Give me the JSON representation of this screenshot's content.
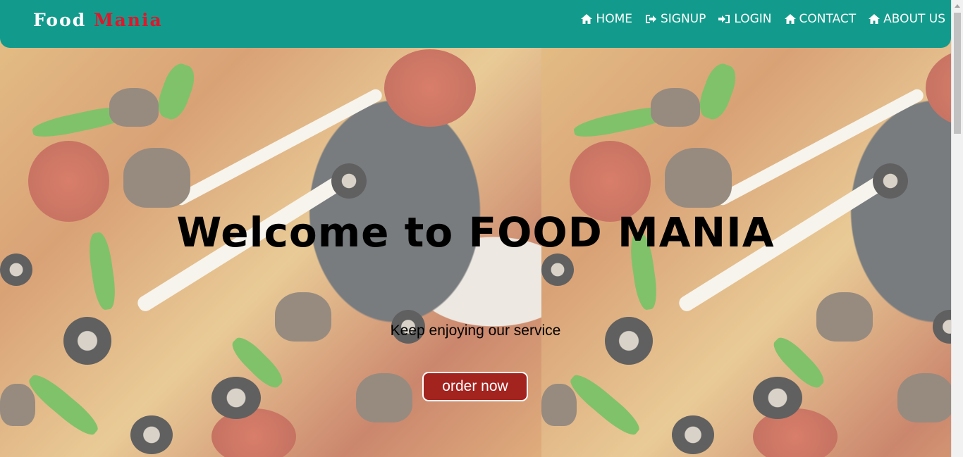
{
  "brand": {
    "first": "Food",
    "second": "Mania"
  },
  "nav": {
    "items": [
      {
        "label": "HOME",
        "icon": "home-icon"
      },
      {
        "label": "SIGNUP",
        "icon": "sign-out-icon"
      },
      {
        "label": "LOGIN",
        "icon": "sign-in-icon"
      },
      {
        "label": "CONTACT",
        "icon": "home-icon"
      },
      {
        "label": "ABOUT US",
        "icon": "home-icon"
      }
    ]
  },
  "hero": {
    "title": "Welcome to FOOD MANIA",
    "subtitle": "Keep enjoying our service",
    "cta_label": "order now",
    "background": "pizza-photo"
  },
  "colors": {
    "navbar": "#129b8c",
    "brand_accent": "#e0162b",
    "cta": "#a3231f"
  }
}
